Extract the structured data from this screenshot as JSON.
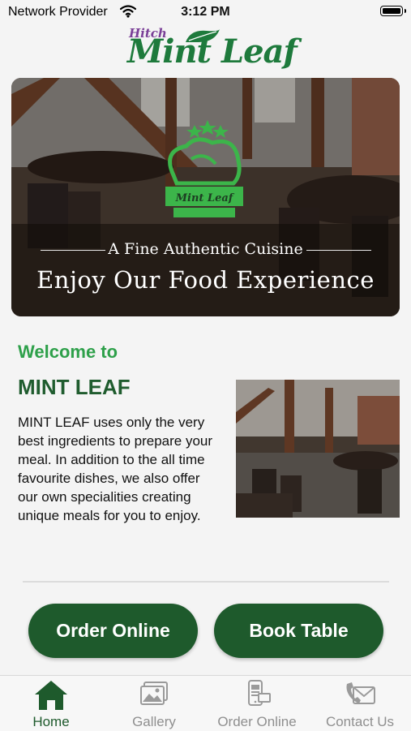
{
  "status_bar": {
    "carrier": "Network Provider",
    "time": "3:12 PM",
    "wifi_icon": "wifi-icon",
    "battery_icon": "battery-icon"
  },
  "logo": {
    "top_text": "Hitch",
    "main_text": "Mint Leaf"
  },
  "hero": {
    "emblem_text": "Mint Leaf",
    "subtitle": "A Fine Authentic Cuisine",
    "title": "Enjoy Our Food Experience"
  },
  "content": {
    "welcome": "Welcome to",
    "brand": "MINT LEAF",
    "description": "MINT LEAF uses only the very best ingredients to prepare your meal. In addition to the all time favourite dishes, we also offer our own specialities creating unique meals for you to enjoy."
  },
  "actions": {
    "order_online": "Order Online",
    "book_table": "Book Table"
  },
  "tabs": [
    {
      "label": "Home",
      "icon": "home-icon",
      "active": true
    },
    {
      "label": "Gallery",
      "icon": "gallery-icon",
      "active": false
    },
    {
      "label": "Order Online",
      "icon": "order-online-icon",
      "active": false
    },
    {
      "label": "Contact Us",
      "icon": "contact-mail-icon",
      "active": false
    }
  ],
  "colors": {
    "primary_green": "#1e5a2c",
    "welcome_green": "#2ea04a",
    "logo_green": "#1e7a3c",
    "logo_purple": "#7a3f97",
    "tab_inactive": "#8f8f8f",
    "background": "#f4f4f4"
  }
}
